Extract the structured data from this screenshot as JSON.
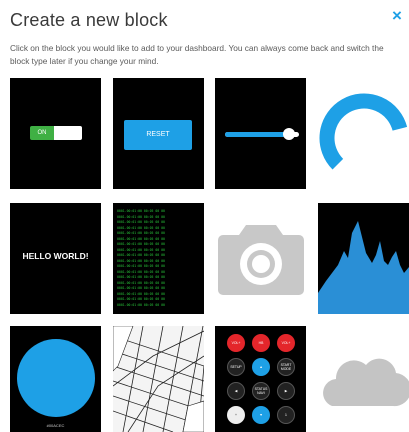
{
  "dialog": {
    "title": "Create a new block",
    "close_icon": "×",
    "description": "Click on the block you would like to add to your dashboard. You can always come back and switch the block type later if you change your mind."
  },
  "blocks": {
    "switch": {
      "on_label": "ON"
    },
    "button": {
      "label": "RESET"
    },
    "slider": {
      "value": 0.87
    },
    "gauge": {
      "value": 0.78
    },
    "text": {
      "label": "HELLO WORLD!"
    },
    "terminal": {
      "lines": [
        "0001.00:01:00 00:05 00 00",
        "0001.00:01:00 00:05 00 00",
        "0001.00:01:00 00:05 00 00",
        "0001.00:01:00 00:05 00 00",
        "0001.00:01:00 00:05 00 00",
        "0001.00:01:00 00:05 00 00",
        "0001.00:01:00 00:05 00 00",
        "0001.00:01:00 00:05 00 00",
        "0001.00:01:00 00:05 00 00",
        "0001.00:01:00 00:05 00 00",
        "0001.00:01:00 00:05 00 00",
        "0001.00:01:00 00:05 00 00",
        "0001.00:01:00 00:05 00 00",
        "0001.00:01:00 00:05 00 00",
        "0001.00:01:00 00:05 00 00",
        "0001.00:01:00 00:05 00 00",
        "0001.00:01:00 00:05 00 00",
        "0001.00:01:00 00:05 00 00"
      ]
    },
    "camera": {},
    "area_chart": {},
    "color_circle": {
      "label": "#00ACEC"
    },
    "map": {},
    "remote": {
      "buttons": [
        [
          "VOL+",
          "HB",
          "VOL+"
        ],
        [
          "SETUP",
          "▲",
          "START MODE"
        ],
        [
          "◀",
          "STATUS NAVI",
          "▶"
        ],
        [
          "+",
          "▼",
          "1"
        ]
      ]
    },
    "cloud": {}
  },
  "colors": {
    "accent": "#1ea0e6",
    "tile_bg": "#000000",
    "switch_on": "#3fb044",
    "terminal_text": "#28c43a",
    "remote_red": "#e4262b"
  },
  "icons": [
    "close-icon",
    "camera-icon",
    "cloud-icon",
    "map-icon"
  ]
}
